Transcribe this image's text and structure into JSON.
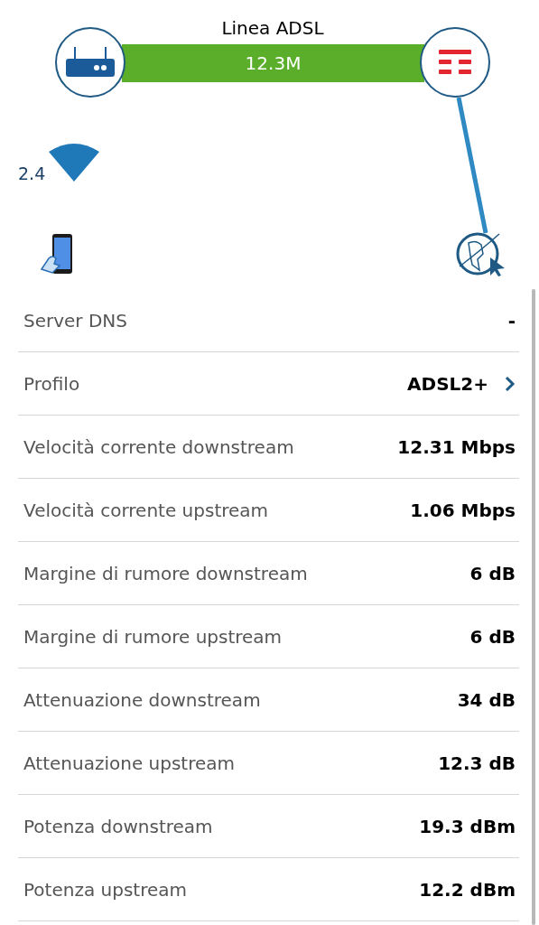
{
  "diagram": {
    "title": "Linea ADSL",
    "speed": "12.3M",
    "wifi_band": "2.4"
  },
  "rows": [
    {
      "label": "Server DNS",
      "value": "-",
      "kind": "plain"
    },
    {
      "label": "Profilo",
      "value": "ADSL2+",
      "kind": "link"
    },
    {
      "label": "Velocità corrente downstream",
      "value": "12.31 Mbps",
      "kind": "plain"
    },
    {
      "label": "Velocità corrente upstream",
      "value": "1.06 Mbps",
      "kind": "plain"
    },
    {
      "label": "Margine di rumore downstream",
      "value": "6 dB",
      "kind": "plain"
    },
    {
      "label": "Margine di rumore upstream",
      "value": "6 dB",
      "kind": "plain"
    },
    {
      "label": "Attenuazione downstream",
      "value": "34 dB",
      "kind": "plain"
    },
    {
      "label": "Attenuazione upstream",
      "value": "12.3 dB",
      "kind": "plain"
    },
    {
      "label": "Potenza downstream",
      "value": "19.3 dBm",
      "kind": "plain"
    },
    {
      "label": "Potenza upstream",
      "value": "12.2 dBm",
      "kind": "plain"
    }
  ]
}
